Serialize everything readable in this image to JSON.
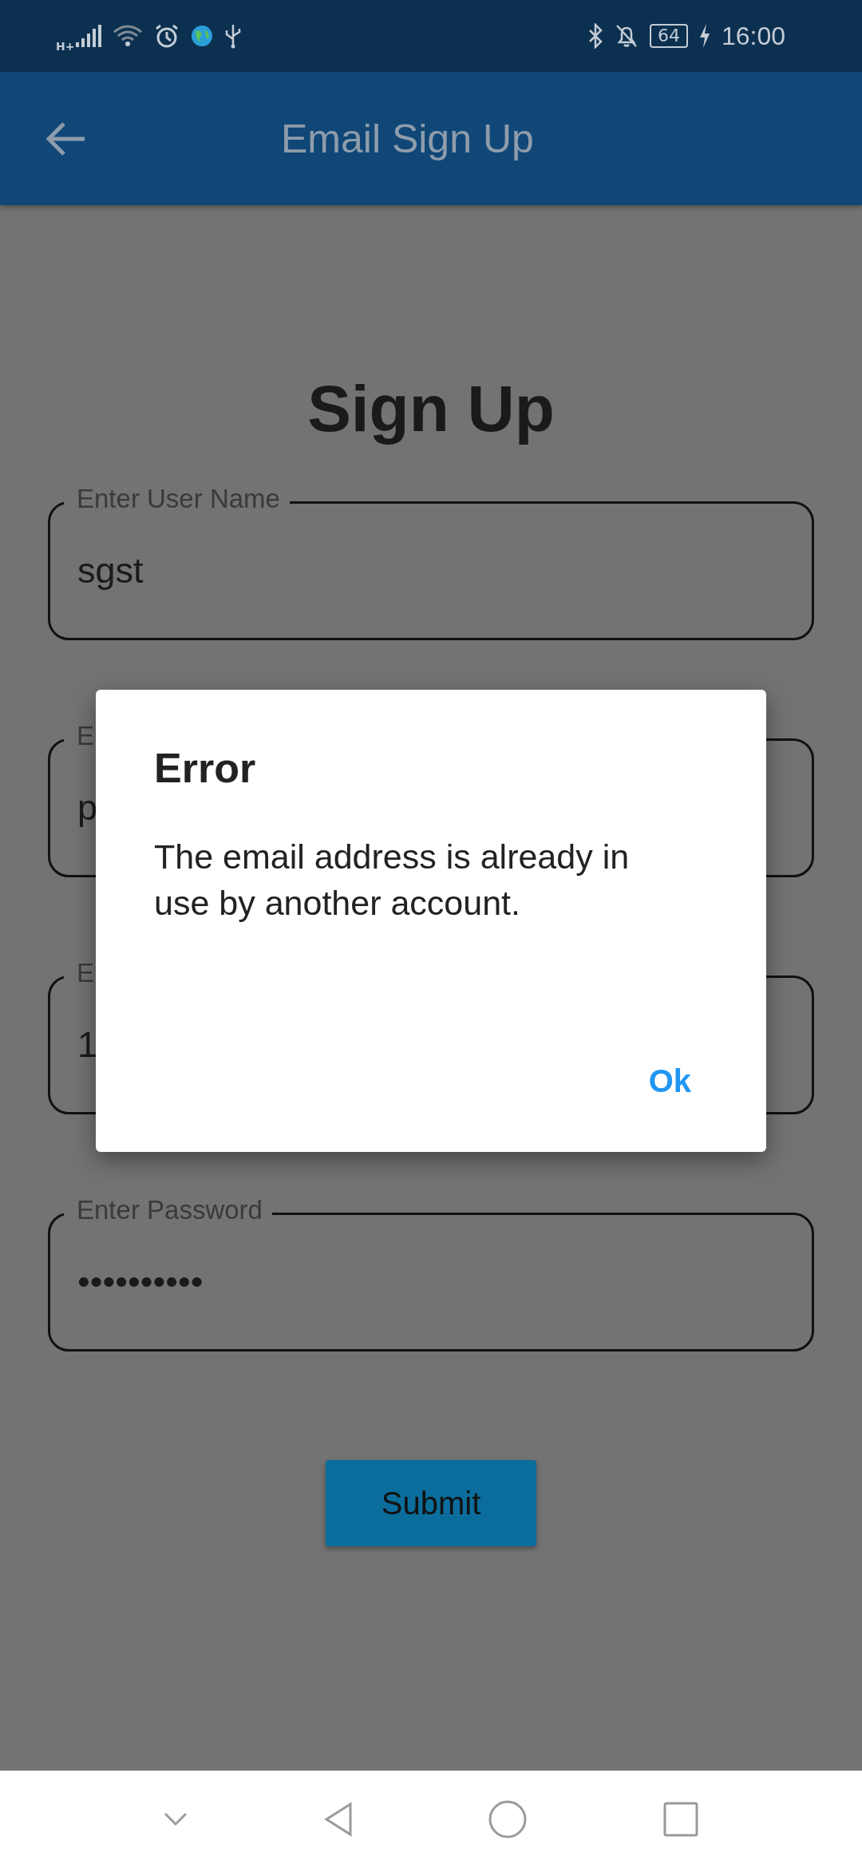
{
  "status_bar": {
    "network": "H+",
    "battery": "64",
    "time": "16:00"
  },
  "app_bar": {
    "title": "Email Sign Up"
  },
  "heading": "Sign Up",
  "fields": [
    {
      "label": "Enter User Name",
      "value": "sgst"
    },
    {
      "label": "E",
      "value": "p"
    },
    {
      "label": "E",
      "value": "1"
    },
    {
      "label": "Enter Password",
      "value": "••••••••••"
    }
  ],
  "submit_button": "Submit",
  "dialog": {
    "title": "Error",
    "message": "The email address is already in use by another account.",
    "button": "Ok"
  }
}
